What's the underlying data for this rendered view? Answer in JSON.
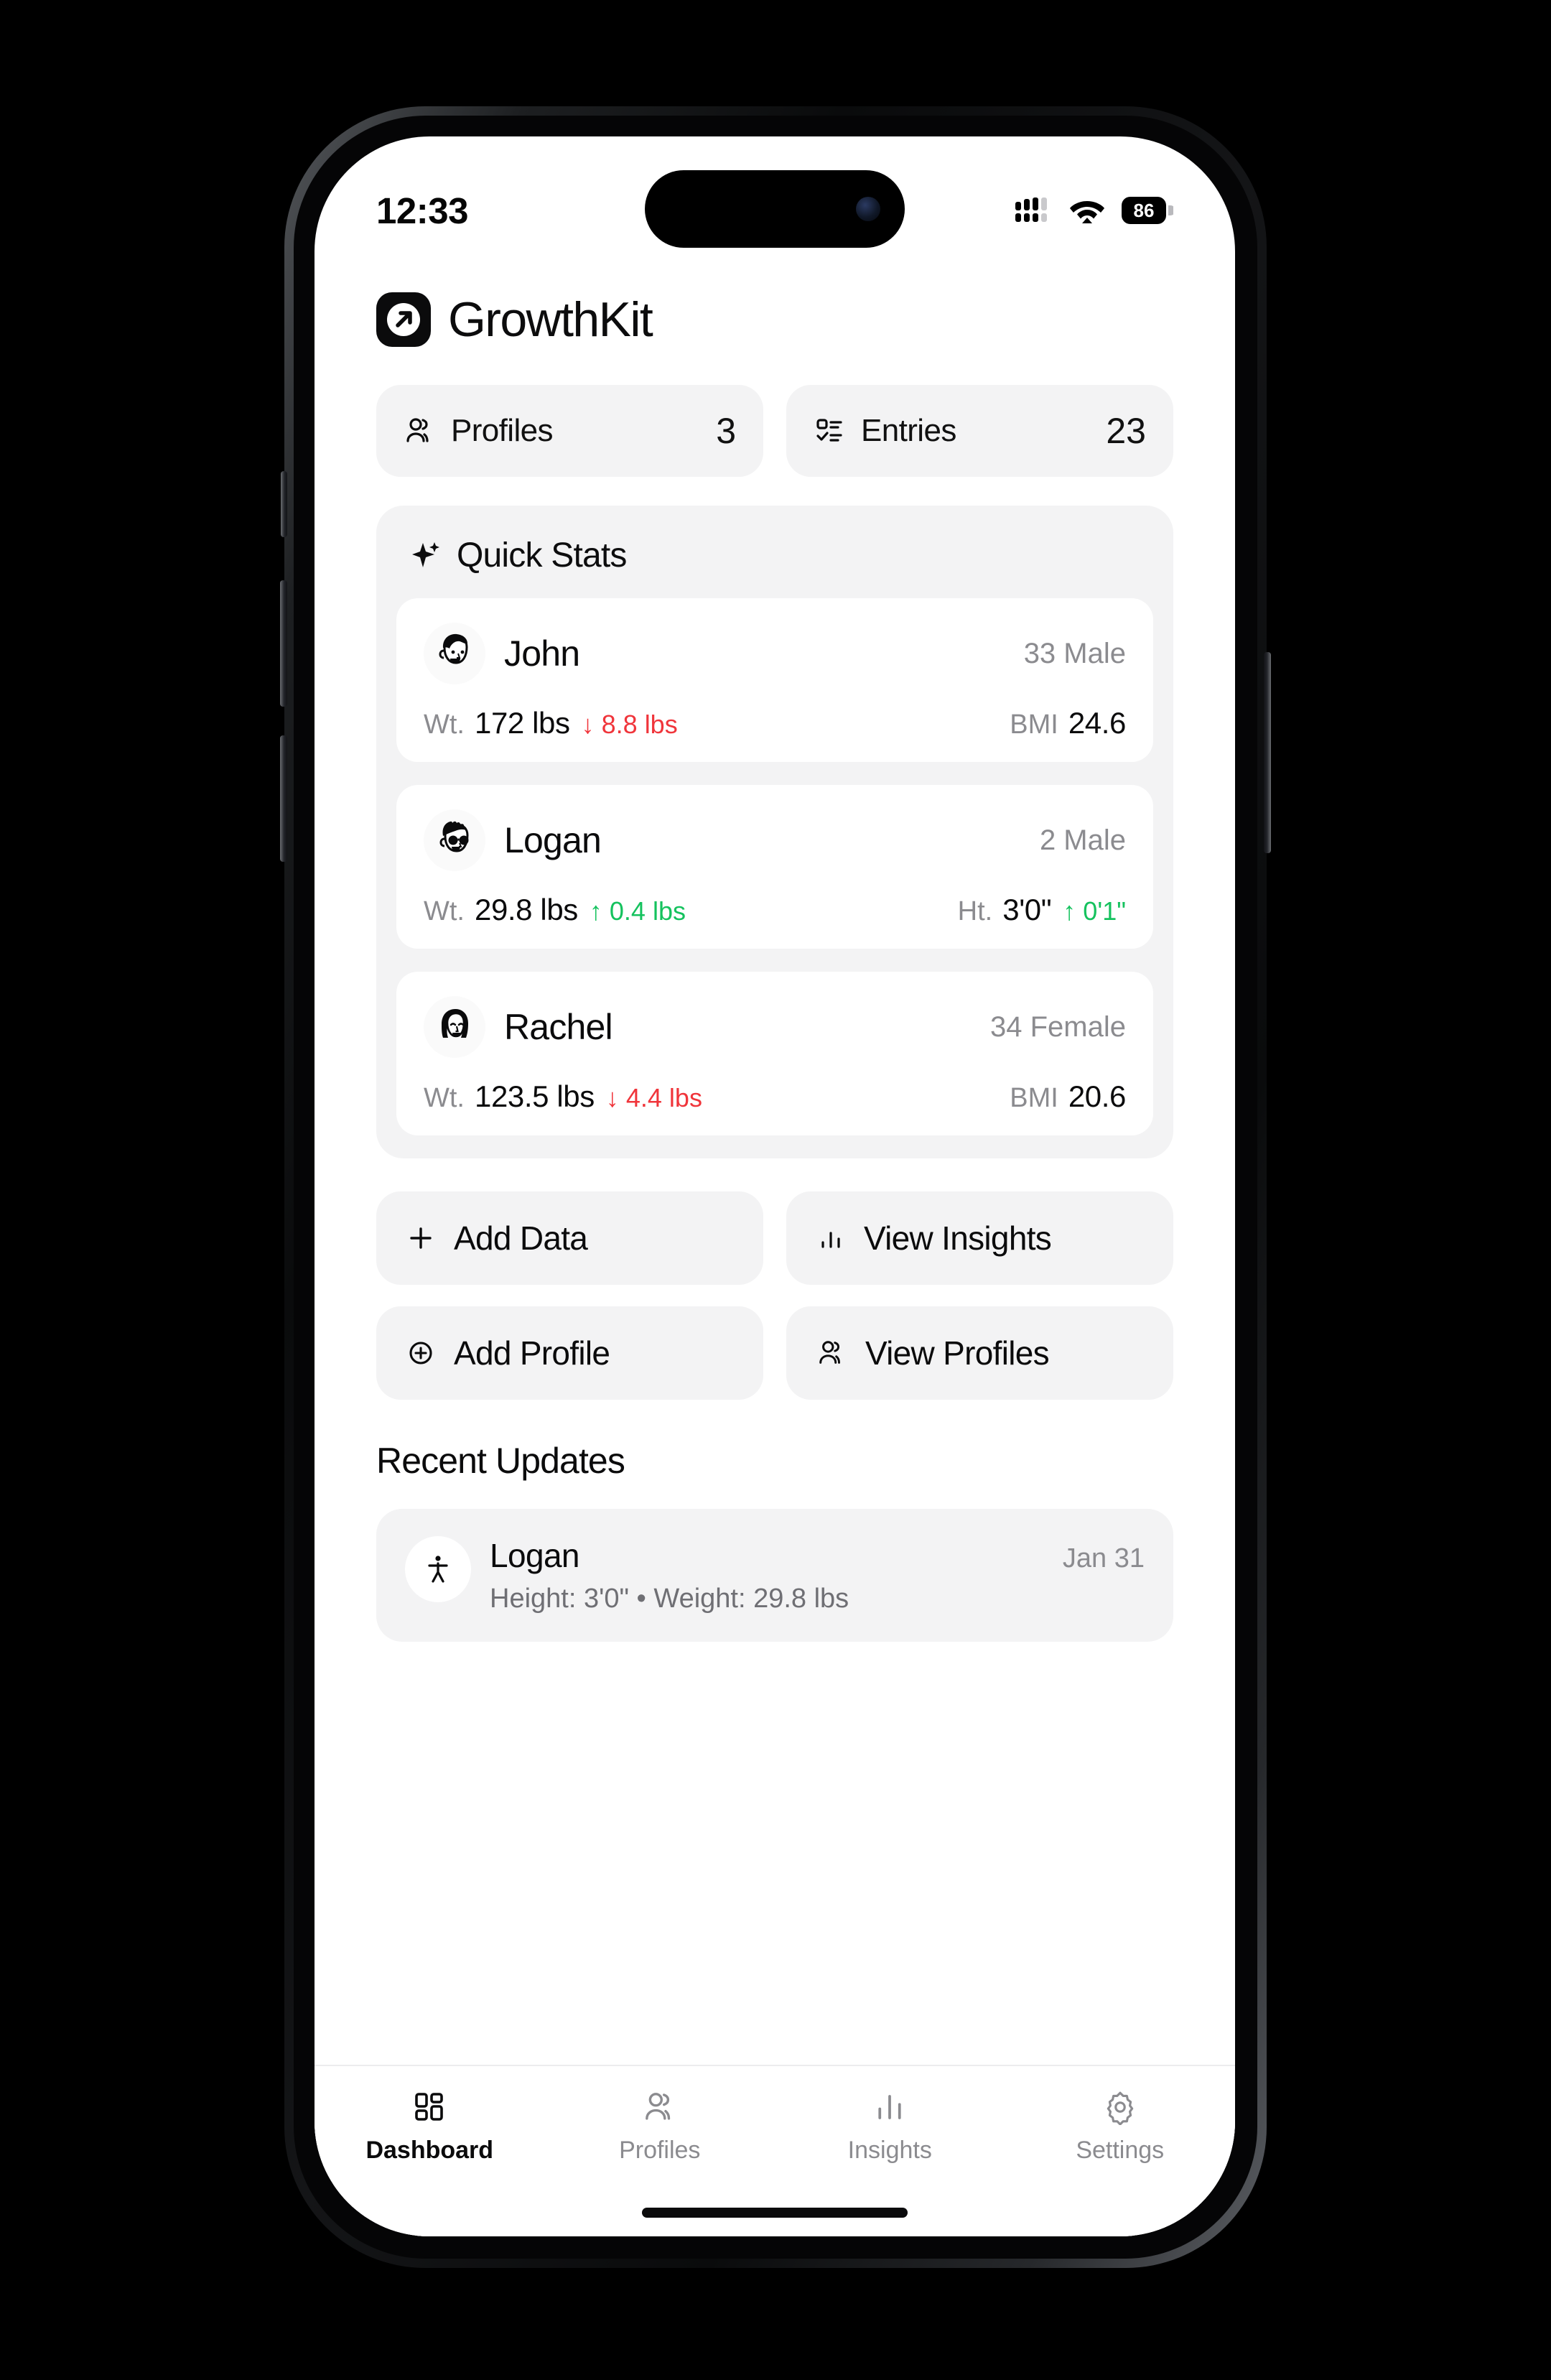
{
  "status_bar": {
    "time": "12:33",
    "battery_percent": "86",
    "wifi_icon": "wifi-icon",
    "cellular_icon": "cellular-signal-icon",
    "battery_icon": "battery-icon"
  },
  "header": {
    "app_name": "GrowthKit",
    "logo_icon": "arrow-up-right-logo-icon"
  },
  "summary_tiles": [
    {
      "label": "Profiles",
      "value": "3",
      "icon": "users-icon"
    },
    {
      "label": "Entries",
      "value": "23",
      "icon": "list-check-icon"
    }
  ],
  "quick_stats": {
    "title": "Quick Stats",
    "icon": "sparkle-icon",
    "profiles": [
      {
        "name": "John",
        "meta": "33 Male",
        "avatar_icon": "avatar-man-icon",
        "left": {
          "label": "Wt.",
          "value": "172 lbs",
          "delta": "8.8 lbs",
          "direction": "down",
          "arrow": "↓"
        },
        "right": {
          "label": "BMI",
          "value": "24.6",
          "delta": "",
          "direction": "none",
          "arrow": ""
        }
      },
      {
        "name": "Logan",
        "meta": "2 Male",
        "avatar_icon": "avatar-boy-sunglasses-icon",
        "left": {
          "label": "Wt.",
          "value": "29.8 lbs",
          "delta": "0.4 lbs",
          "direction": "up",
          "arrow": "↑"
        },
        "right": {
          "label": "Ht.",
          "value": "3'0\"",
          "delta": "0'1\"",
          "direction": "up",
          "arrow": "↑"
        }
      },
      {
        "name": "Rachel",
        "meta": "34 Female",
        "avatar_icon": "avatar-woman-icon",
        "left": {
          "label": "Wt.",
          "value": "123.5 lbs",
          "delta": "4.4 lbs",
          "direction": "down",
          "arrow": "↓"
        },
        "right": {
          "label": "BMI",
          "value": "20.6",
          "delta": "",
          "direction": "none",
          "arrow": ""
        }
      }
    ]
  },
  "actions": [
    {
      "label": "Add Data",
      "icon": "plus-icon"
    },
    {
      "label": "View Insights",
      "icon": "bar-chart-icon"
    },
    {
      "label": "Add Profile",
      "icon": "plus-circle-icon"
    },
    {
      "label": "View Profiles",
      "icon": "users-icon"
    }
  ],
  "recent_updates": {
    "title": "Recent Updates",
    "items": [
      {
        "name": "Logan",
        "date": "Jan 31",
        "details": "Height: 3'0\" • Weight: 29.8 lbs",
        "icon": "person-standing-icon"
      }
    ]
  },
  "tab_bar": [
    {
      "label": "Dashboard",
      "icon": "grid-dashboard-icon",
      "active": true
    },
    {
      "label": "Profiles",
      "icon": "users-icon",
      "active": false
    },
    {
      "label": "Insights",
      "icon": "bar-chart-icon",
      "active": false
    },
    {
      "label": "Settings",
      "icon": "gear-icon",
      "active": false
    }
  ],
  "colors": {
    "accent": "#0b0b0c",
    "surface": "#f3f3f4",
    "muted": "#8b8b8f",
    "up": "#15c25e",
    "down": "#f0353b"
  }
}
